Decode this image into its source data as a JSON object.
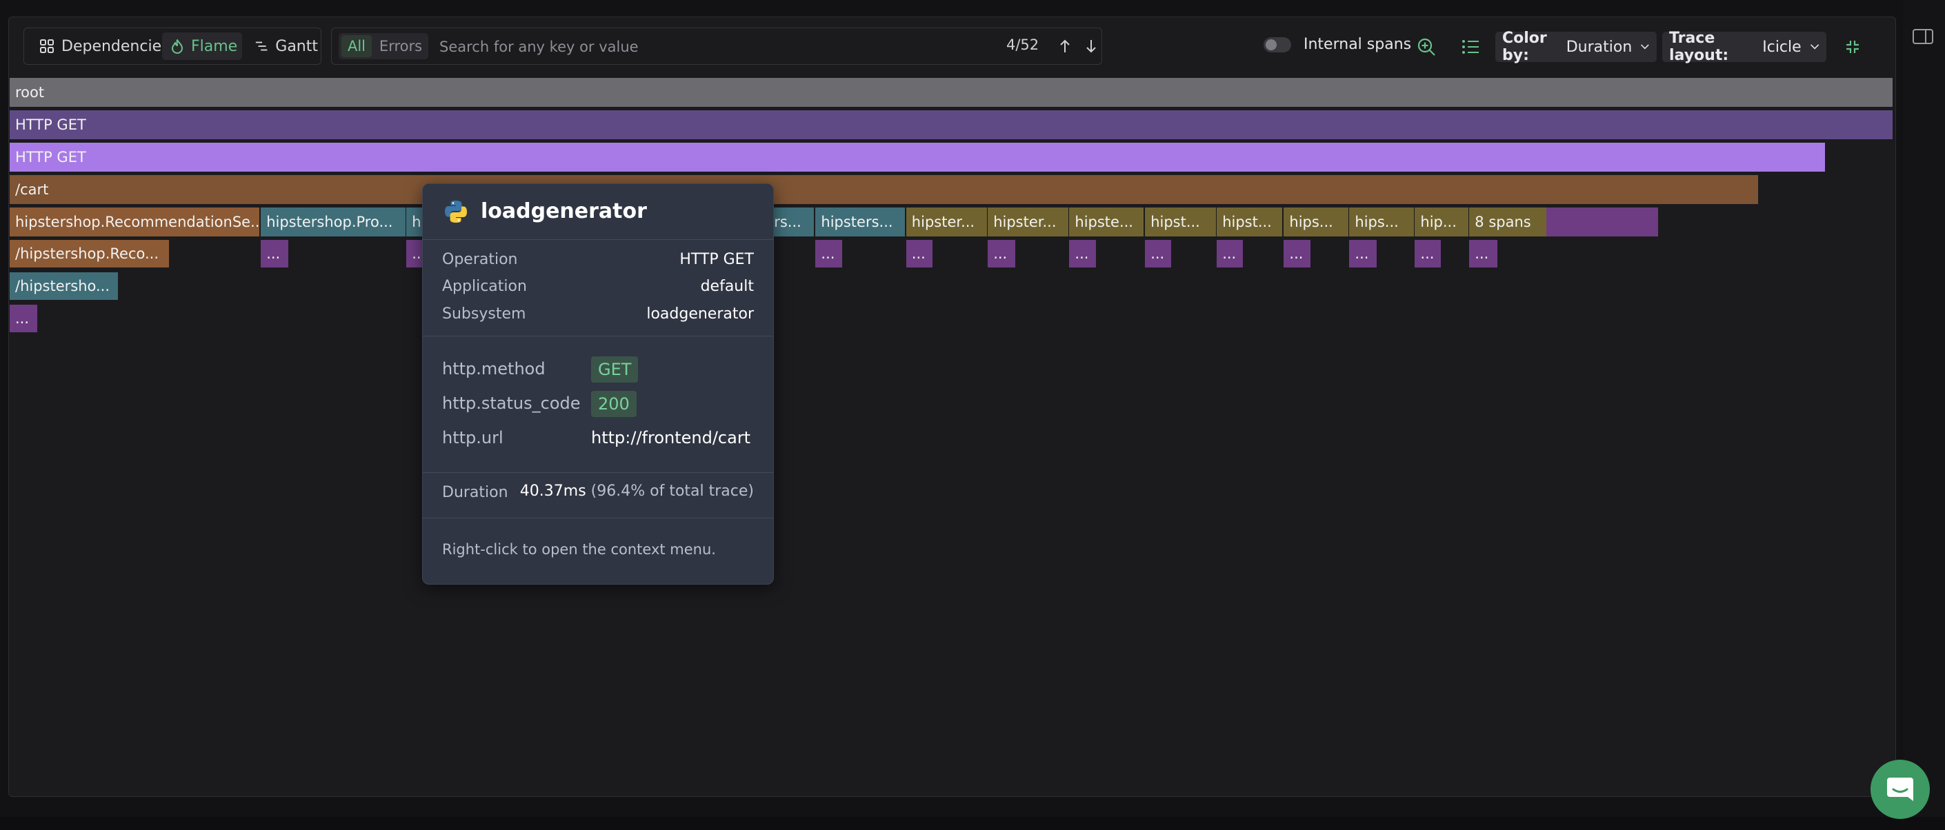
{
  "toolbar": {
    "views": [
      {
        "label": "Dependencies",
        "icon": "dependencies-icon",
        "active": false
      },
      {
        "label": "Flame",
        "icon": "flame-icon",
        "active": true
      },
      {
        "label": "Gantt",
        "icon": "gantt-icon",
        "active": false
      }
    ],
    "filters": [
      {
        "label": "All",
        "active": true
      },
      {
        "label": "Errors",
        "active": false
      }
    ],
    "search_placeholder": "Search for any key or value",
    "match_counter": "4/52",
    "internal_spans_label": "Internal spans",
    "internal_spans_enabled": false,
    "color_by": {
      "label": "Color by:",
      "value": "Duration"
    },
    "trace_layout": {
      "label": "Trace layout:",
      "value": "Icicle"
    }
  },
  "colors": {
    "accent": "#69c28a",
    "root": "#6b6b70",
    "http_dark": "#5f4a86",
    "http_light": "#a87ae8",
    "cart": "#7e5434",
    "recommendation": "#8c5a35",
    "teal": "#3f6e79",
    "olive": "#70632f",
    "purple": "#6e3c83"
  },
  "flame": {
    "rows": [
      [
        {
          "label": "root",
          "color": "#6b6b70",
          "start": 0,
          "end": 100
        }
      ],
      [
        {
          "label": "HTTP GET",
          "color": "#5f4a86",
          "start": 0,
          "end": 100
        }
      ],
      [
        {
          "label": "HTTP GET",
          "color": "#a87ae8",
          "start": 0,
          "end": 96.4
        }
      ],
      [
        {
          "label": "/cart",
          "color": "#7e5434",
          "start": 0,
          "end": 92.86
        }
      ],
      [
        {
          "label": "hipstershop.RecommendationSe...",
          "color": "#8c5a35",
          "start": 0,
          "end": 13.27
        },
        {
          "label": "hipstershop.Pro...",
          "color": "#3f6e79",
          "start": 13.34,
          "end": 21.01
        },
        {
          "label": "h",
          "color": "#3f6e79",
          "start": 21.07,
          "end": 22.3
        },
        {
          "label": "rs...",
          "color": "#3f6e79",
          "start": 40.3,
          "end": 42.7
        },
        {
          "label": "hipsters...",
          "color": "#3f6e79",
          "start": 42.8,
          "end": 47.55
        },
        {
          "label": "hipster...",
          "color": "#70632f",
          "start": 47.61,
          "end": 51.89
        },
        {
          "label": "hipster...",
          "color": "#70632f",
          "start": 51.95,
          "end": 56.22
        },
        {
          "label": "hipste...",
          "color": "#70632f",
          "start": 56.28,
          "end": 60.23
        },
        {
          "label": "hipst...",
          "color": "#70632f",
          "start": 60.3,
          "end": 64.05
        },
        {
          "label": "hipst...",
          "color": "#70632f",
          "start": 64.11,
          "end": 67.6
        },
        {
          "label": "hips...",
          "color": "#70632f",
          "start": 67.67,
          "end": 71.09
        },
        {
          "label": "hips...",
          "color": "#70632f",
          "start": 71.15,
          "end": 74.57
        },
        {
          "label": "hip...",
          "color": "#70632f",
          "start": 74.63,
          "end": 77.46
        },
        {
          "label": "8 spans",
          "color": "#70632f",
          "start": 77.52,
          "end": 81.6
        },
        {
          "label": "",
          "color": "#6e3c83",
          "start": 81.6,
          "end": 87.54
        }
      ],
      [
        {
          "label": "/hipstershop.Reco...",
          "color": "#8c5a35",
          "start": 0,
          "end": 8.45
        },
        {
          "label": "...",
          "color": "#6e3c83",
          "start": 13.34,
          "end": 14.8
        },
        {
          "label": "...",
          "color": "#6e3c83",
          "start": 21.07,
          "end": 22.3
        },
        {
          "label": "...",
          "color": "#6e3c83",
          "start": 42.8,
          "end": 44.2
        },
        {
          "label": "...",
          "color": "#6e3c83",
          "start": 47.61,
          "end": 49.0
        },
        {
          "label": "...",
          "color": "#6e3c83",
          "start": 51.95,
          "end": 53.4
        },
        {
          "label": "...",
          "color": "#6e3c83",
          "start": 56.28,
          "end": 57.7
        },
        {
          "label": "...",
          "color": "#6e3c83",
          "start": 60.3,
          "end": 61.7
        },
        {
          "label": "...",
          "color": "#6e3c83",
          "start": 64.11,
          "end": 65.5
        },
        {
          "label": "...",
          "color": "#6e3c83",
          "start": 67.67,
          "end": 69.1
        },
        {
          "label": "...",
          "color": "#6e3c83",
          "start": 71.15,
          "end": 72.6
        },
        {
          "label": "...",
          "color": "#6e3c83",
          "start": 74.63,
          "end": 76.0
        },
        {
          "label": "...",
          "color": "#6e3c83",
          "start": 77.52,
          "end": 79.0
        }
      ],
      [
        {
          "label": "/hipstersho...",
          "color": "#3f6e79",
          "start": 0,
          "end": 5.75
        }
      ],
      [
        {
          "label": "...",
          "color": "#6e3c83",
          "start": 0,
          "end": 1.45
        }
      ]
    ]
  },
  "tooltip": {
    "service": "loadgenerator",
    "service_icon": "python-icon",
    "fields": [
      {
        "label": "Operation",
        "value": "HTTP GET"
      },
      {
        "label": "Application",
        "value": "default"
      },
      {
        "label": "Subsystem",
        "value": "loadgenerator"
      }
    ],
    "attributes": [
      {
        "key": "http.method",
        "value": "GET",
        "badge": true
      },
      {
        "key": "http.status_code",
        "value": "200",
        "badge": true
      },
      {
        "key": "http.url",
        "value": "http://frontend/cart",
        "badge": false
      }
    ],
    "duration_label": "Duration",
    "duration_value": "40.37ms",
    "duration_share": "(96.4% of total trace)",
    "hint": "Right-click to open the context menu."
  }
}
